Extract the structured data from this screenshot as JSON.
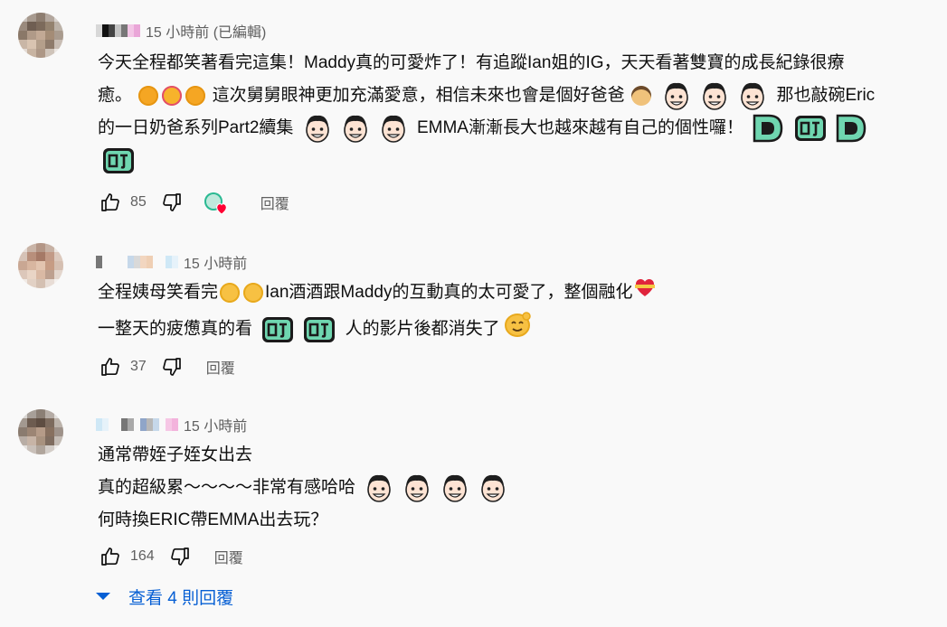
{
  "comments": [
    {
      "time": "15 小時前 (已編輯)",
      "text": [
        "今天全程都笑著看完這集！Maddy真的可愛炸了！有追蹤Ian姐的IG，天天看著雙寶的成長紀錄很療",
        "癒。",
        "這次舅舅眼神更加充滿愛意，相信未來也會是個好爸爸",
        "那也敲碗Eric",
        "的一日奶爸系列Part2續集",
        "EMMA漸漸長大也越來越有自己的個性囉！"
      ],
      "likes": "85",
      "reply_label": "回覆",
      "has_creator_heart": true
    },
    {
      "time": "15 小時前",
      "text": [
        "全程姨母笑看完",
        "Ian酒酒跟Maddy的互動真的太可愛了，整個融化",
        "一整天的疲憊真的看",
        "人的影片後都消失了"
      ],
      "likes": "37",
      "reply_label": "回覆"
    },
    {
      "time": "15 小時前",
      "text": [
        "通常帶姪子姪女出去",
        "真的超級累～～～～非常有感哈哈",
        "何時換ERIC帶EMMA出去玩？"
      ],
      "likes": "164",
      "reply_label": "回覆"
    }
  ],
  "view_replies": {
    "label": "查看 4 則回覆"
  },
  "icons": [
    "thumbs-up-icon",
    "thumbs-down-icon",
    "heart-icon",
    "chevron-down-icon"
  ],
  "colors": {
    "link": "#065fd4",
    "secondary_text": "#606060",
    "heart": "#ff0033",
    "sticker_green": "#2ab992"
  }
}
